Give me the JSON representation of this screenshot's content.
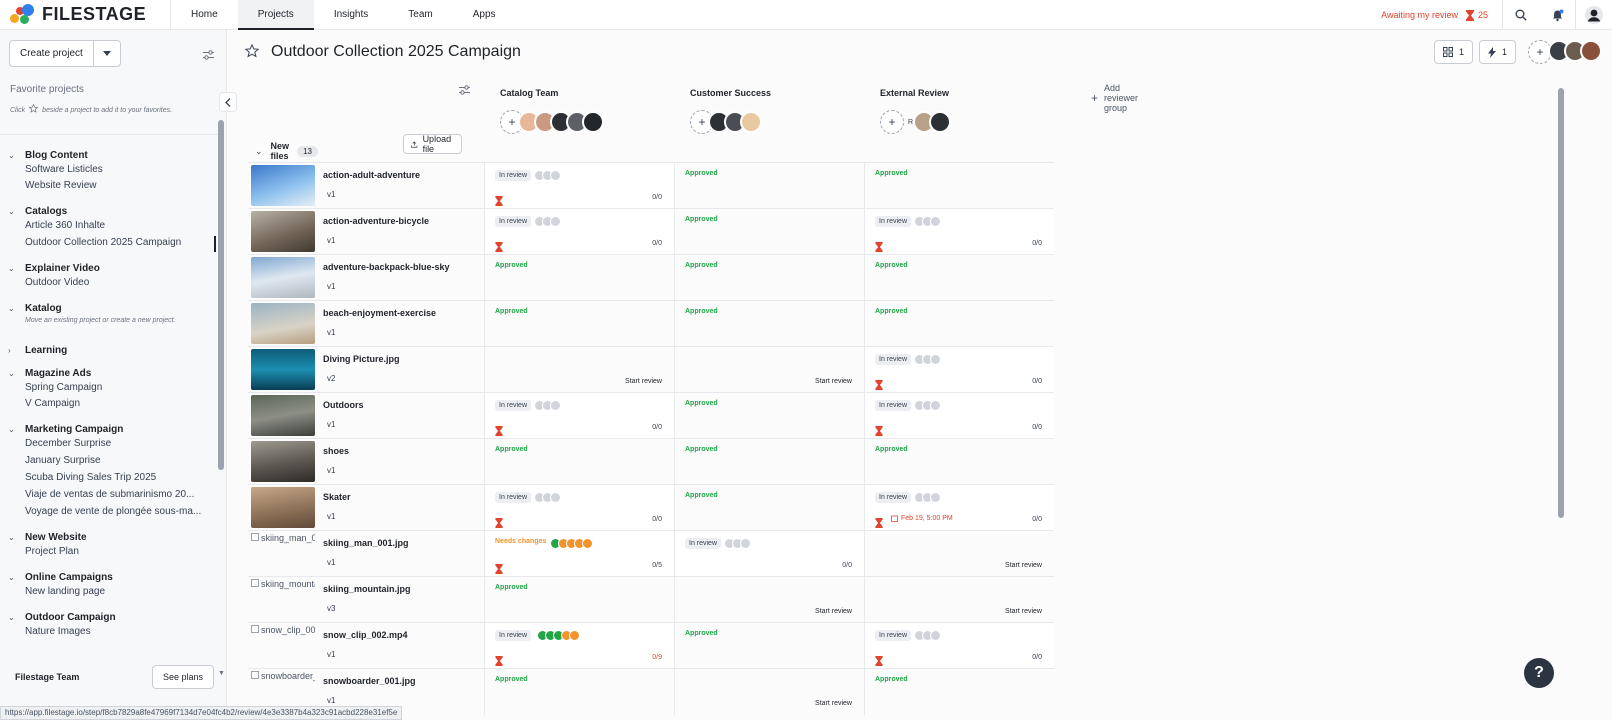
{
  "brand": {
    "name": "FILESTAGE"
  },
  "nav": {
    "items": [
      "Home",
      "Projects",
      "Insights",
      "Team",
      "Apps"
    ],
    "active": "Projects"
  },
  "topbar": {
    "awaiting_label": "Awaiting my review",
    "awaiting_count": "25"
  },
  "sidebar": {
    "create_label": "Create project",
    "favorites_title": "Favorite projects",
    "favorites_hint_before": "Click",
    "favorites_hint_after": "beside a project to add it to your favorites.",
    "groups": [
      {
        "label": "Blog Content",
        "items": [
          "Software Listicles",
          "Website Review"
        ]
      },
      {
        "label": "Catalogs",
        "items": [
          "Article 360 Inhalte",
          "Outdoor Collection 2025 Campaign"
        ]
      },
      {
        "label": "Explainer Video",
        "items": [
          "Outdoor Video"
        ]
      },
      {
        "label": "Katalog",
        "hint": "Move an existing project or create a new project."
      },
      {
        "label": "Learning",
        "items": []
      },
      {
        "label": "Magazine Ads",
        "items": [
          "Spring Campaign",
          "V Campaign"
        ]
      },
      {
        "label": "Marketing Campaign",
        "items": [
          "December Surprise",
          "January Surprise",
          "Scuba Diving Sales Trip 2025",
          "Viaje de ventas de submarinismo 20...",
          "Voyage de vente de plongée sous-ma..."
        ]
      },
      {
        "label": "New Website",
        "items": [
          "Project Plan"
        ]
      },
      {
        "label": "Online Campaigns",
        "items": [
          "New landing page"
        ]
      },
      {
        "label": "Outdoor Campaign",
        "items": [
          "Nature Images"
        ]
      }
    ],
    "team_label": "Filestage Team",
    "see_plans": "See plans"
  },
  "header": {
    "title": "Outdoor Collection 2025 Campaign",
    "files_count": "1",
    "automation_count": "1"
  },
  "groups": [
    {
      "name": "Catalog Team"
    },
    {
      "name": "Customer Success"
    },
    {
      "name": "External Review",
      "initial": "R"
    }
  ],
  "add_group_label": "Add reviewer group",
  "files_section": {
    "label": "New files",
    "count": "13",
    "upload_label": "Upload file"
  },
  "files": [
    {
      "name": "action-adult-adventure",
      "version": "v1",
      "reviews": [
        {
          "status": "In review",
          "count": "0/0"
        },
        {
          "status": "Approved"
        },
        {
          "status": "Approved"
        }
      ]
    },
    {
      "name": "action-adventure-bicycle",
      "version": "v1",
      "reviews": [
        {
          "status": "In review",
          "count": "0/0"
        },
        {
          "status": "Approved"
        },
        {
          "status": "In review",
          "count": "0/0"
        }
      ]
    },
    {
      "name": "adventure-backpack-blue-sky",
      "version": "v1",
      "reviews": [
        {
          "status": "Approved"
        },
        {
          "status": "Approved"
        },
        {
          "status": "Approved"
        }
      ]
    },
    {
      "name": "beach-enjoyment-exercise",
      "version": "v1",
      "reviews": [
        {
          "status": "Approved"
        },
        {
          "status": "Approved"
        },
        {
          "status": "Approved"
        }
      ]
    },
    {
      "name": "Diving Picture.jpg",
      "version": "v2",
      "reviews": [
        {
          "start": "Start review"
        },
        {
          "start": "Start review"
        },
        {
          "status": "In review",
          "count": "0/0"
        }
      ]
    },
    {
      "name": "Outdoors",
      "version": "v1",
      "reviews": [
        {
          "status": "In review",
          "count": "0/0"
        },
        {
          "status": "Approved"
        },
        {
          "status": "In review",
          "count": "0/0"
        }
      ]
    },
    {
      "name": "shoes",
      "version": "v1",
      "reviews": [
        {
          "status": "Approved"
        },
        {
          "status": "Approved"
        },
        {
          "status": "Approved"
        }
      ]
    },
    {
      "name": "Skater",
      "version": "v1",
      "reviews": [
        {
          "status": "In review",
          "count": "0/0"
        },
        {
          "status": "Approved"
        },
        {
          "status": "In review",
          "count": "0/0",
          "due": "Feb 19, 5:00 PM"
        }
      ]
    },
    {
      "name": "skiing_man_001.jpg",
      "version": "v1",
      "alt": "skiing_man_00",
      "reviews": [
        {
          "status": "Needs changes",
          "count": "0/5"
        },
        {
          "status": "In review",
          "count": "0/0",
          "nohg": true
        },
        {
          "start": "Start review"
        }
      ]
    },
    {
      "name": "skiing_mountain.jpg",
      "version": "v3",
      "alt": "skiing_mounta",
      "reviews": [
        {
          "status": "Approved"
        },
        {
          "start": "Start review"
        },
        {
          "start": "Start review"
        }
      ]
    },
    {
      "name": "snow_clip_002.mp4",
      "version": "v1",
      "alt": "snow_clip_002",
      "reviews": [
        {
          "status": "In review",
          "count": "0/9",
          "warn": true
        },
        {
          "status": "Approved"
        },
        {
          "status": "In review",
          "count": "0/0"
        }
      ]
    },
    {
      "name": "snowboarder_001.jpg",
      "version": "v1",
      "alt": "snowboarder_",
      "reviews": [
        {
          "status": "Approved"
        },
        {
          "start": "Start review"
        },
        {
          "status": "Approved"
        }
      ]
    }
  ],
  "status_url": "https://app.filestage.io/step/f8cb7829a8fe47969f7134d7e04fc4b2/review/4e3e3387b4a323c91acbd228e31ef5e",
  "colors": {
    "approved": "#22a447",
    "needs_changes": "#f2932b",
    "warn": "#e0442d",
    "accent": "#1f2329"
  }
}
